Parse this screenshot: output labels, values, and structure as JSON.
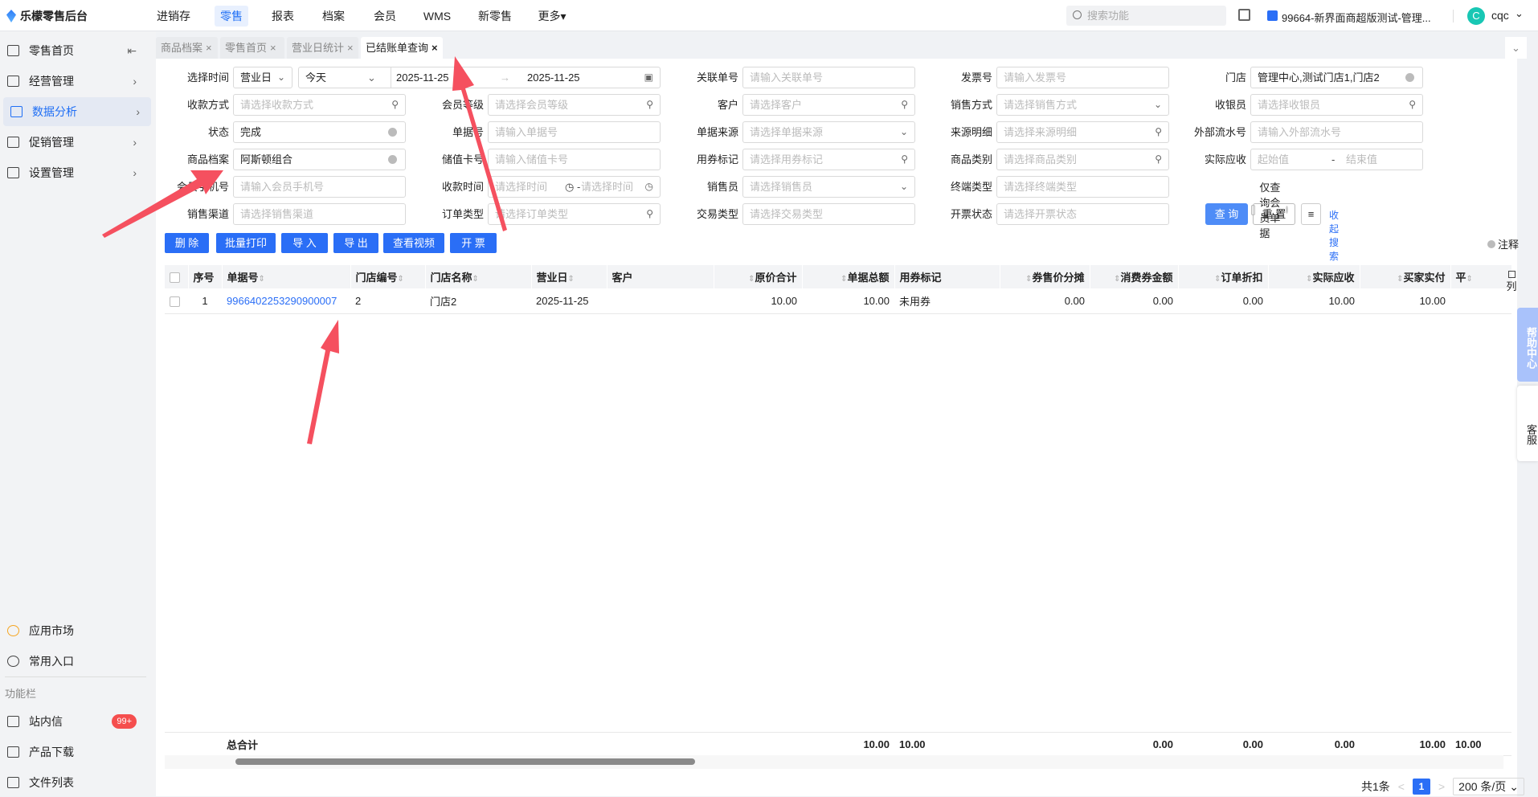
{
  "app": {
    "logo_text": "乐檬零售后台"
  },
  "topnav": [
    {
      "label": "进销存"
    },
    {
      "label": "零售",
      "active": true
    },
    {
      "label": "报表"
    },
    {
      "label": "档案"
    },
    {
      "label": "会员"
    },
    {
      "label": "WMS"
    },
    {
      "label": "新零售"
    },
    {
      "label": "更多▾"
    }
  ],
  "header": {
    "search_placeholder": "搜索功能",
    "store": "99664-新界面商超版测试-管理...",
    "avatar_letter": "C",
    "user": "cqc"
  },
  "sidebar": {
    "items": [
      {
        "label": "零售首页",
        "icon": "home-icon"
      },
      {
        "label": "经营管理",
        "icon": "monitor-icon"
      },
      {
        "label": "数据分析",
        "icon": "chart-icon",
        "active": true
      },
      {
        "label": "促销管理",
        "icon": "promo-icon"
      },
      {
        "label": "设置管理",
        "icon": "folder-icon"
      }
    ],
    "bottom": [
      {
        "label": "应用市场",
        "icon": "app-market-icon"
      },
      {
        "label": "常用入口",
        "icon": "heart-icon"
      }
    ],
    "section_label": "功能栏",
    "tools": [
      {
        "label": "站内信",
        "icon": "mail-icon",
        "badge": "99+"
      },
      {
        "label": "产品下载",
        "icon": "download-icon"
      },
      {
        "label": "文件列表",
        "icon": "file-list-icon"
      }
    ]
  },
  "tabs": [
    {
      "label": "商品档案"
    },
    {
      "label": "零售首页"
    },
    {
      "label": "营业日统计"
    },
    {
      "label": "已结账单查询",
      "active": true
    }
  ],
  "filters": {
    "time": {
      "label": "选择时间",
      "type": "营业日",
      "range": "今天",
      "start": "2025-11-25",
      "end": "2025-11-25"
    },
    "fields": [
      {
        "label": "关联单号",
        "placeholder": "请输入关联单号",
        "row": 0,
        "col": 2
      },
      {
        "label": "发票号",
        "placeholder": "请输入发票号",
        "row": 0,
        "col": 3
      },
      {
        "label": "门店",
        "value": "管理中心,测试门店1,门店2",
        "suffix": "clear",
        "row": 0,
        "col": 4
      },
      {
        "label": "收款方式",
        "placeholder": "请选择收款方式",
        "suffix": "search",
        "row": 1,
        "col": 0
      },
      {
        "label": "会员等级",
        "placeholder": "请选择会员等级",
        "suffix": "search",
        "row": 1,
        "col": 1
      },
      {
        "label": "客户",
        "placeholder": "请选择客户",
        "suffix": "search",
        "row": 1,
        "col": 2
      },
      {
        "label": "销售方式",
        "placeholder": "请选择销售方式",
        "suffix": "chevron",
        "row": 1,
        "col": 3
      },
      {
        "label": "收银员",
        "placeholder": "请选择收银员",
        "suffix": "search",
        "row": 1,
        "col": 4
      },
      {
        "label": "状态",
        "value": "完成",
        "suffix": "clear",
        "row": 2,
        "col": 0
      },
      {
        "label": "单据号",
        "placeholder": "请输入单据号",
        "row": 2,
        "col": 1
      },
      {
        "label": "单据来源",
        "placeholder": "请选择单据来源",
        "suffix": "chevron",
        "row": 2,
        "col": 2
      },
      {
        "label": "来源明细",
        "placeholder": "请选择来源明细",
        "suffix": "search",
        "row": 2,
        "col": 3
      },
      {
        "label": "外部流水号",
        "placeholder": "请输入外部流水号",
        "row": 2,
        "col": 4
      },
      {
        "label": "商品档案",
        "value": "阿斯顿组合",
        "suffix": "clear",
        "row": 3,
        "col": 0
      },
      {
        "label": "储值卡号",
        "placeholder": "请输入储值卡号",
        "row": 3,
        "col": 1
      },
      {
        "label": "用券标记",
        "placeholder": "请选择用券标记",
        "suffix": "search",
        "row": 3,
        "col": 2
      },
      {
        "label": "商品类别",
        "placeholder": "请选择商品类别",
        "suffix": "search",
        "row": 3,
        "col": 3
      },
      {
        "label": "实际应收",
        "placeholder": "起始值",
        "placeholder2": "结束值",
        "range": true,
        "row": 3,
        "col": 4
      },
      {
        "label": "会员手机号",
        "placeholder": "请输入会员手机号",
        "row": 4,
        "col": 0
      },
      {
        "label": "收款时间",
        "placeholder": "请选择时间",
        "placeholder2": "请选择时间",
        "range": true,
        "clock": true,
        "row": 4,
        "col": 1
      },
      {
        "label": "销售员",
        "placeholder": "请选择销售员",
        "suffix": "chevron",
        "row": 4,
        "col": 2
      },
      {
        "label": "终端类型",
        "placeholder": "请选择终端类型",
        "row": 4,
        "col": 3
      },
      {
        "label": "销售渠道",
        "placeholder": "请选择销售渠道",
        "row": 5,
        "col": 0
      },
      {
        "label": "订单类型",
        "placeholder": "请选择订单类型",
        "suffix": "search",
        "row": 5,
        "col": 1
      },
      {
        "label": "交易类型",
        "placeholder": "请选择交易类型",
        "row": 5,
        "col": 2
      },
      {
        "label": "开票状态",
        "placeholder": "请选择开票状态",
        "row": 5,
        "col": 3
      }
    ],
    "member_only": {
      "label": "仅查询会员单据",
      "checked": false
    },
    "query": "查 询",
    "reset": "重 置",
    "collapse": "收起搜索"
  },
  "actions": [
    "删 除",
    "批量打印",
    "导 入",
    "导 出",
    "查看视频",
    "开 票"
  ],
  "note": "注释",
  "table": {
    "columns": [
      {
        "label": "序号"
      },
      {
        "label": "单据号",
        "sort": true
      },
      {
        "label": "门店编号",
        "sort": true
      },
      {
        "label": "门店名称",
        "sort": true
      },
      {
        "label": "营业日",
        "sort": true
      },
      {
        "label": "客户"
      },
      {
        "label": "原价合计",
        "sort": true,
        "num": true
      },
      {
        "label": "单据总额",
        "sort": true,
        "num": true
      },
      {
        "label": "用券标记"
      },
      {
        "label": "券售价分摊",
        "sort": true,
        "num": true
      },
      {
        "label": "消费券金额",
        "sort": true,
        "num": true
      },
      {
        "label": "订单折扣",
        "sort": true,
        "num": true
      },
      {
        "label": "实际应收",
        "sort": true,
        "num": true
      },
      {
        "label": "买家实付",
        "sort": true,
        "num": true
      },
      {
        "label": "平",
        "sort": true
      }
    ],
    "rows": [
      [
        "1",
        "9966402253290900007",
        "2",
        "门店2",
        "2025-11-25",
        "",
        "10.00",
        "10.00",
        "未用券",
        "0.00",
        "0.00",
        "0.00",
        "10.00",
        "10.00",
        ""
      ]
    ],
    "footer": {
      "label": "总合计",
      "values": [
        "",
        "",
        "",
        "",
        "",
        "10.00",
        "10.00",
        "",
        "0.00",
        "0.00",
        "0.00",
        "10.00",
        "10.00",
        ""
      ]
    },
    "column_setting": "列"
  },
  "pagination": {
    "total": "共1条",
    "page": "1",
    "page_size": "200 条/页"
  },
  "float": {
    "help": "帮助中心",
    "service": "客服"
  },
  "colors": {
    "accent": "#2a6ef6",
    "badge": "#f54e4e",
    "annotation_arrow": "#f5505f"
  }
}
